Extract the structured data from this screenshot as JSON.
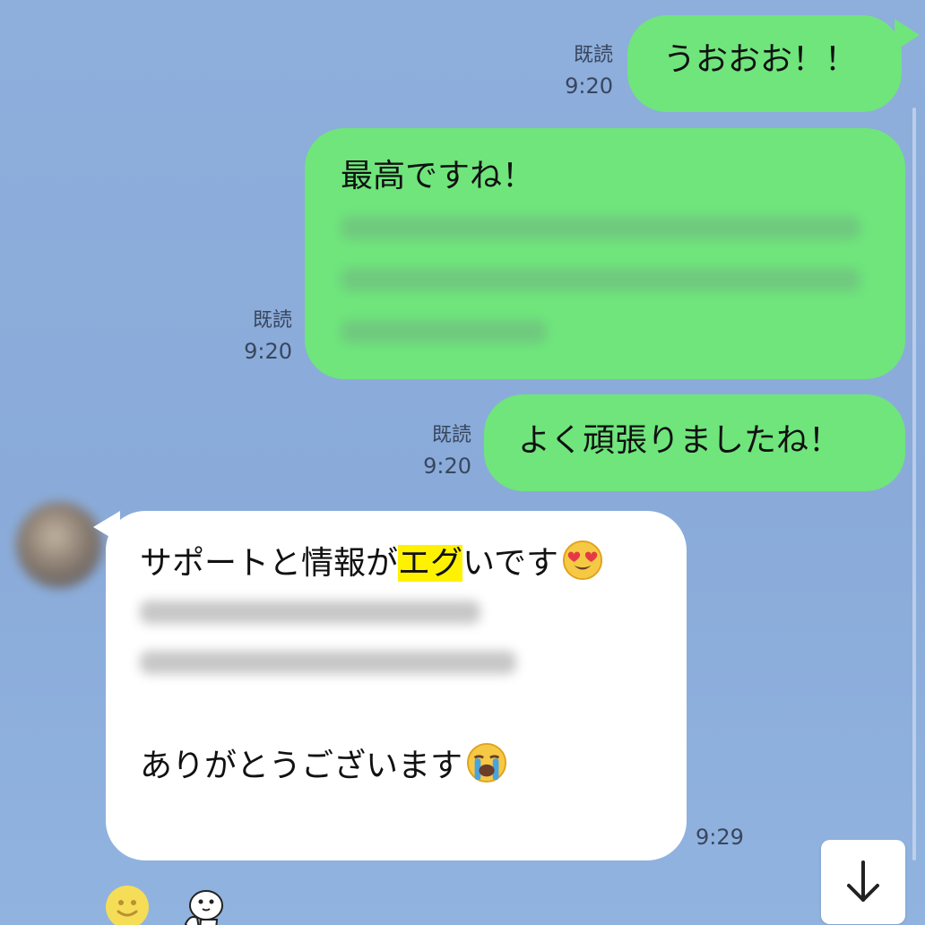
{
  "messages": {
    "m1": {
      "text": "うおおお！！",
      "read": "既読",
      "time": "9:20"
    },
    "m2": {
      "text": "最高ですね！",
      "read": "既読",
      "time": "9:20"
    },
    "m3": {
      "text": "よく頑張りましたね！",
      "read": "既読",
      "time": "9:20"
    },
    "incoming": {
      "before_highlight": "サポートと情報が",
      "highlight": "エグ",
      "after_highlight": "いです",
      "thanks": "ありがとうございます",
      "time": "9:29"
    }
  },
  "icons": {
    "heart_eyes": "heart-eyes-emoji-icon",
    "crying": "loudly-crying-emoji-icon",
    "smile": "smile-reaction-icon",
    "sticker": "sticker-icon",
    "arrow_down": "arrow-down-icon"
  },
  "colors": {
    "background": "#8caddc",
    "sent_bubble": "#6fe57c",
    "received_bubble": "#ffffff",
    "highlight": "#fff200"
  }
}
